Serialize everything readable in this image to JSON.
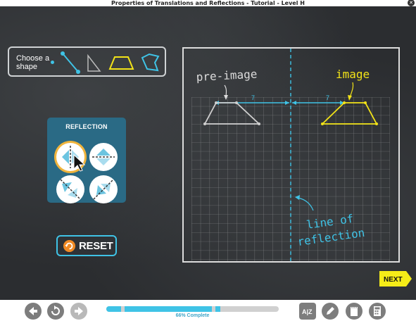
{
  "window": {
    "title": "Properties of Translations and Reflections - Tutorial - Level H"
  },
  "chooser": {
    "label": "Choose a shape",
    "shapes": [
      "segment",
      "triangle",
      "trapezoid",
      "quadrilateral"
    ],
    "selected": "trapezoid"
  },
  "reflection_panel": {
    "title": "REFLECTION",
    "options": [
      "vertical-line",
      "horizontal-line",
      "diagonal-down",
      "diagonal-up"
    ],
    "selected": "vertical-line"
  },
  "reset": {
    "label": "RESET"
  },
  "board": {
    "pre_image_label": "pre-image",
    "image_label": "image",
    "left_distance": "7",
    "right_distance": "7",
    "line_label": "line of reflection"
  },
  "next": {
    "label": "NEXT"
  },
  "progress": {
    "value": 0.66,
    "text": "66% Complete"
  },
  "colors": {
    "accent": "#3fc3e6",
    "image": "#f2e318",
    "selected_ring": "#f0b43c",
    "reset_icon": "#f08a24",
    "next": "#f5ec18"
  },
  "toolbar": {
    "icons": [
      "back-icon",
      "replay-icon",
      "forward-icon",
      "glossary-icon",
      "pencil-icon",
      "notepad-icon",
      "calculator-icon"
    ]
  }
}
